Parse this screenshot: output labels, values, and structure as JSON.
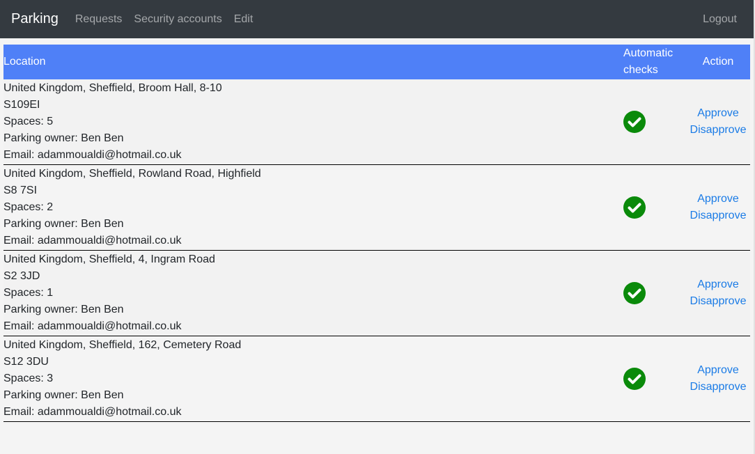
{
  "navbar": {
    "brand": "Parking",
    "links": [
      "Requests",
      "Security accounts",
      "Edit"
    ],
    "logout": "Logout"
  },
  "table": {
    "headers": {
      "location": "Location",
      "checks_line1": "Automatic",
      "checks_line2": "checks",
      "action": "Action"
    },
    "rows": [
      {
        "address": "United Kingdom, Sheffield, Broom Hall, 8-10",
        "postcode": "S109EI",
        "spaces": "Spaces: 5",
        "owner": "Parking owner: Ben Ben",
        "email": "Email: adammoualdi@hotmail.co.uk",
        "approve": "Approve",
        "disapprove": "Disapprove"
      },
      {
        "address": "United Kingdom, Sheffield, Rowland Road, Highfield",
        "postcode": "S8 7SI",
        "spaces": "Spaces: 2",
        "owner": "Parking owner: Ben Ben",
        "email": "Email: adammoualdi@hotmail.co.uk",
        "approve": "Approve",
        "disapprove": "Disapprove"
      },
      {
        "address": "United Kingdom, Sheffield, 4, Ingram Road",
        "postcode": "S2 3JD",
        "spaces": "Spaces: 1",
        "owner": "Parking owner: Ben Ben",
        "email": "Email: adammoualdi@hotmail.co.uk",
        "approve": "Approve",
        "disapprove": "Disapprove"
      },
      {
        "address": "United Kingdom, Sheffield, 162, Cemetery Road",
        "postcode": "S12 3DU",
        "spaces": "Spaces: 3",
        "owner": "Parking owner: Ben Ben",
        "email": "Email: adammoualdi@hotmail.co.uk",
        "approve": "Approve",
        "disapprove": "Disapprove"
      }
    ]
  },
  "icons": {
    "check": "check-circle-icon"
  },
  "colors": {
    "navbar": "#343a40",
    "header": "#4f80f7",
    "check": "#0a8a0a",
    "link": "#1a7be6"
  }
}
